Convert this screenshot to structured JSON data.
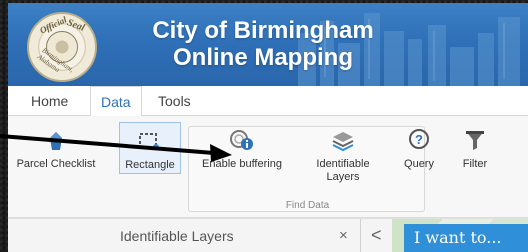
{
  "header": {
    "title_line1": "City of Birmingham",
    "title_line2": "Online Mapping",
    "seal": {
      "text_top_left": "Official",
      "text_top_right": "Seal",
      "text_bottom": "Birmingham, Alabama"
    },
    "colors": {
      "header_blue": "#2f70b8",
      "accent_blue": "#2f8fd8"
    }
  },
  "tabs": [
    {
      "label": "Home"
    },
    {
      "label": "Data",
      "active": true
    },
    {
      "label": "Tools"
    }
  ],
  "ribbon": {
    "tools": [
      {
        "label": "Parcel Checklist",
        "icon": "tower-icon"
      },
      {
        "label": "Rectangle",
        "icon": "rectangle-select-icon",
        "selected": true
      },
      {
        "label": "Enable buffering",
        "icon": "buffer-info-icon"
      },
      {
        "label_line1": "Identifiable",
        "label_line2": "Layers",
        "icon": "layers-icon"
      },
      {
        "label": "Query",
        "icon": "query-icon"
      },
      {
        "label": "Filter",
        "icon": "filter-icon"
      }
    ],
    "group_label": "Find Data"
  },
  "panel": {
    "title": "Identifiable Layers",
    "close_glyph": "×",
    "back_glyph": "<",
    "i_want_to": "I want to..."
  }
}
